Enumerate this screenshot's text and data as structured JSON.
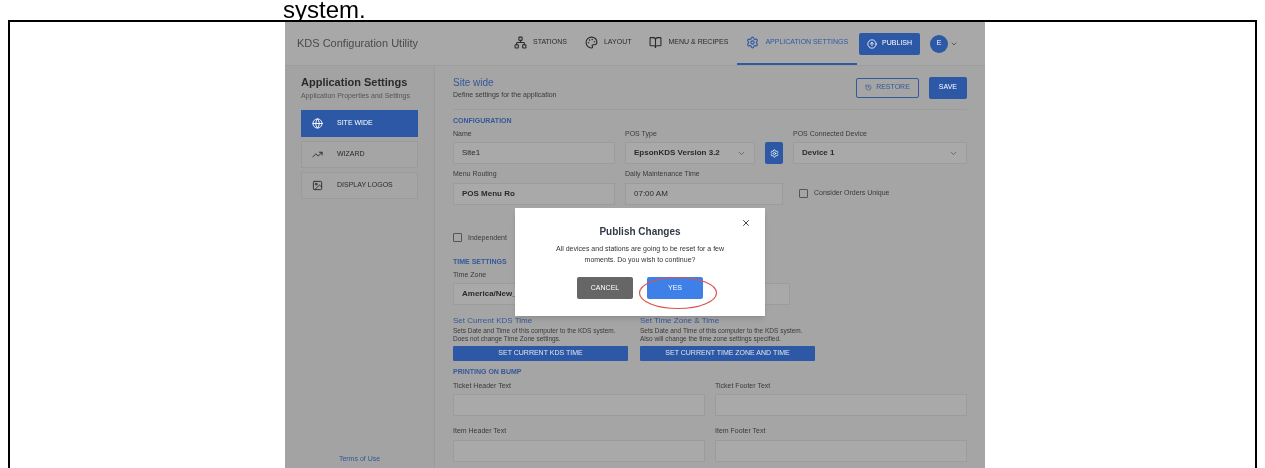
{
  "doc_text": "system.",
  "app": {
    "title": "KDS Configuration Utility",
    "nav": [
      {
        "label": "STATIONS",
        "selected": false
      },
      {
        "label": "LAYOUT",
        "selected": false
      },
      {
        "label": "MENU & RECIPES",
        "selected": false
      },
      {
        "label": "APPLICATION SETTINGS",
        "selected": true
      }
    ],
    "publish": "PUBLISH",
    "avatar": "E"
  },
  "sidebar": {
    "title": "Application Settings",
    "subtitle": "Application Properties and Settings",
    "items": [
      {
        "label": "SITE WIDE",
        "selected": true
      },
      {
        "label": "WIZARD",
        "selected": false
      },
      {
        "label": "DISPLAY LOGOS",
        "selected": false
      }
    ],
    "footer_link": "Terms of Use"
  },
  "content": {
    "title": "Site wide",
    "subtitle": "Define settings for the application",
    "restore": "RESTORE",
    "save": "SAVE",
    "configuration": {
      "heading": "CONFIGURATION",
      "name": {
        "label": "Name",
        "value": "Site1"
      },
      "pos_type": {
        "label": "POS Type",
        "value": "EpsonKDS Version 3.2"
      },
      "pos_device": {
        "label": "POS Connected Device",
        "value": "Device 1"
      },
      "menu_routing": {
        "label": "Menu Routing",
        "value": "POS Menu Ro"
      },
      "maintenance": {
        "label": "Daily Maintenance Time",
        "value": "07:00 AM"
      },
      "consider_unique": {
        "label": "Consider Orders Unique",
        "checked": false
      },
      "independent": {
        "label": "Independent",
        "checked": false
      }
    },
    "time_settings": {
      "heading": "TIME SETTINGS",
      "time_zone": {
        "label": "Time Zone",
        "value": "America/New_"
      },
      "actions": [
        {
          "title": "Set Current KDS Time",
          "lines": [
            "Sets Date and Time of this computer to the KDS system.",
            "Does not change Time Zone settings."
          ],
          "button": "SET CURRENT KDS TIME"
        },
        {
          "title": "Set Time Zone & Time",
          "lines": [
            "Sets Date and Time of this computer to the KDS system.",
            "Also will change the time zone settings specified."
          ],
          "button": "SET CURRENT TIME ZONE AND TIME"
        }
      ]
    },
    "printing": {
      "heading": "PRINTING ON BUMP",
      "fields": [
        {
          "label": "Ticket Header Text"
        },
        {
          "label": "Ticket Footer Text"
        },
        {
          "label": "Item Header Text"
        },
        {
          "label": "Item Footer Text"
        }
      ]
    }
  },
  "dialog": {
    "title": "Publish Changes",
    "message": "All devices and stations are going to be reset for a few moments. Do you wish to continue?",
    "cancel": "CANCEL",
    "confirm": "YES"
  }
}
